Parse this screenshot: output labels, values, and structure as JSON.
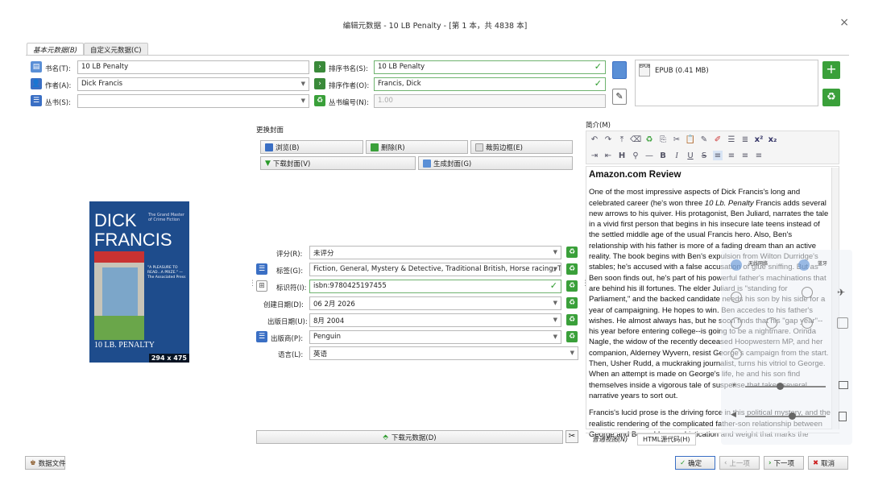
{
  "window": {
    "title": "编辑元数据 - 10 LB Penalty - [第 1 本，共 4838 本]",
    "close": "×"
  },
  "tabs": [
    {
      "label": "基本元数据(B)"
    },
    {
      "label": "自定义元数据(C)"
    }
  ],
  "fields": {
    "title_label": "书名(T):",
    "title_value": "10 LB Penalty",
    "sort_title_label": "排序书名(S):",
    "sort_title_value": "10 LB Penalty",
    "author_label": "作者(A):",
    "author_value": "Dick Francis",
    "sort_author_label": "排序作者(O):",
    "sort_author_value": "Francis, Dick",
    "series_label": "丛书(S):",
    "series_value": "",
    "series_index_label": "丛书编号(N):",
    "series_index_value": "1.00"
  },
  "format": {
    "name": "EPUB (0.41 MB)"
  },
  "cover": {
    "section_label": "更换封面",
    "browse": "浏览(B)",
    "remove": "删除(R)",
    "trim": "裁剪边框(E)",
    "download": "下载封面(V)",
    "generate": "生成封面(G)",
    "author_line1": "DICK",
    "author_line2": "FRANCIS",
    "tagline": "The Grand Master of Crime Fiction",
    "quote": "\"A PLEASURE TO READ...A PRIZE.\" —The Associated Press",
    "book_title": "10 LB. PENALTY",
    "dims": "294 x 475"
  },
  "meta": {
    "rating_label": "评分(R):",
    "rating_value": "未评分",
    "tags_label": "标签(G):",
    "tags_value": "Fiction, General, Mystery & Detective, Traditional British, Horse racing, Translat",
    "ids_label": "标识符(I):",
    "ids_value": "isbn:9780425197455",
    "created_label": "创建日期(D):",
    "created_value": "06 2月 2026",
    "pubdate_label": "出版日期(U):",
    "pubdate_value": "8月 2004",
    "publisher_label": "出版商(P):",
    "publisher_value": "Penguin",
    "language_label": "语言(L):",
    "language_value": "英语"
  },
  "download_metadata": "下载元数据(D)",
  "comments": {
    "label": "简介(M)",
    "heading": "Amazon.com Review",
    "p1a": "One of the most impressive aspects of Dick Francis's long and celebrated career (he's won three ",
    "p1i": "10 Lb. Penalty",
    "p1b": " Francis adds several new arrows to his quiver. His protagonist, Ben Juliard, narrates the tale in a vivid first person that begins in his insecure late teens instead of the settled middle age of the usual Francis hero. Also, Ben's relationship with his father is more of a fading dream than an active reality. The book begins with Ben's expulsion from Wilton Durridge's stables; he's accused with a false accusation of glue sniffing. But as Ben soon finds out, he's part of his powerful father's machinations that are behind his ill fortunes. The elder Juliard is \"standing for Parliament,\" and the backed candidate needs his son by his side for a year of campaigning. He hopes to win. Ben accedes to his father's wishes. He almost always has, but he soon finds that his \"gap year\"--his year before entering college--is going to be a nightmare. Orinda Nagle, the widow of the recently deceased Hoopwestern MP, and her companion, Alderney Wyvern, resist George's campaign from the start. Then, Usher Rudd, a muckraking journalist, turns his vitriol to George. When an attempt is made on George's life, he and his son find themselves inside a vigorous tale of suspense that takes several narrative years to sort out.",
    "p2": "Francis's lucid prose is the driving force in this political mystery, and the realistic rendering of the complicated father-son relationship between George and Ben adds a sophistication and weight that marks the",
    "tab_normal": "普通视图(N)",
    "tab_html": "HTML源代码(H)"
  },
  "overlay": {
    "wifi": "无线网络",
    "bluetooth": "蓝牙"
  },
  "bottom": {
    "data_files": "数据文件",
    "ok": "确定",
    "prev": "上一项",
    "next": "下一项",
    "cancel": "取消"
  },
  "colors": {
    "accent_green": "#2a9a2a",
    "accent_blue": "#3a6fc4",
    "cover_blue": "#1e4c8c",
    "cancel_red": "#cc2222"
  }
}
